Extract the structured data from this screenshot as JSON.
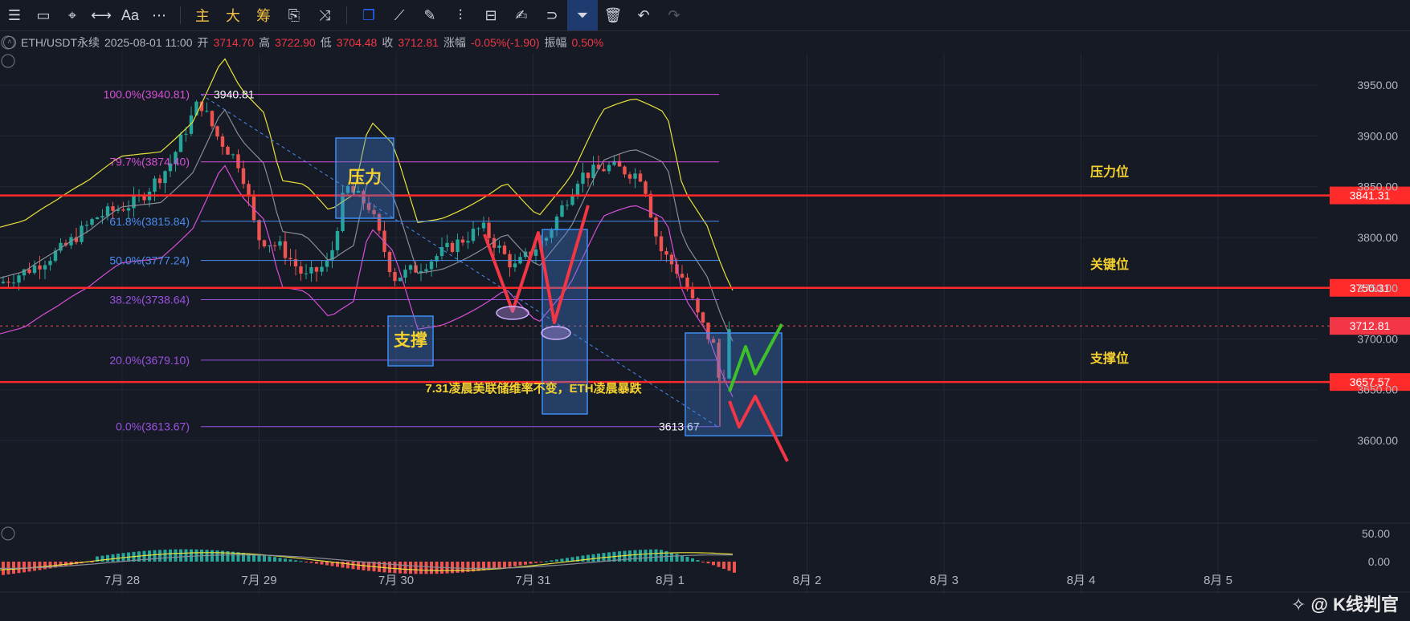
{
  "toolbar": {
    "items": [
      {
        "icon": "menu-icon",
        "glyph": "☰"
      },
      {
        "icon": "rectangle-icon",
        "glyph": "▭"
      },
      {
        "icon": "cursor-icon",
        "glyph": "⌖"
      },
      {
        "icon": "horizontal-line-icon",
        "glyph": "⟷"
      },
      {
        "icon": "text-icon",
        "glyph": "Aa"
      },
      {
        "icon": "more-icon",
        "glyph": "⋯"
      },
      {
        "icon": "main-indicator-button",
        "glyph": "主",
        "gold": true
      },
      {
        "icon": "large-button",
        "glyph": "大",
        "gold": true
      },
      {
        "icon": "chips-button",
        "glyph": "筹",
        "gold": true
      },
      {
        "icon": "compare-icon",
        "glyph": "⎘"
      },
      {
        "icon": "draw-tool-icon",
        "glyph": "⤨"
      },
      {
        "icon": "copy-icon",
        "glyph": "❐",
        "blue": true
      },
      {
        "icon": "ruler-icon",
        "glyph": "⟋"
      },
      {
        "icon": "pen-icon",
        "glyph": "✎"
      },
      {
        "icon": "bar-chart-icon",
        "glyph": "⫶"
      },
      {
        "icon": "trash-can-icon",
        "glyph": "⊟"
      },
      {
        "icon": "note-icon",
        "glyph": "✍"
      },
      {
        "icon": "magnet-icon",
        "glyph": "⊃"
      },
      {
        "icon": "filter-icon",
        "glyph": "⏷",
        "active": true
      },
      {
        "icon": "delete-icon",
        "glyph": "🗑"
      },
      {
        "icon": "undo-icon",
        "glyph": "↶"
      },
      {
        "icon": "redo-icon",
        "glyph": "↷",
        "dim": true
      }
    ]
  },
  "info": {
    "symbol": "ETH/USDT永续",
    "time": "2025-08-01 11:00",
    "open_label": "开",
    "open": "3714.70",
    "high_label": "高",
    "high": "3722.90",
    "low_label": "低",
    "low": "3704.48",
    "close_label": "收",
    "close": "3712.81",
    "change_label": "涨幅",
    "change": "-0.05%(-1.90)",
    "amp_label": "振幅",
    "amp": "0.50%"
  },
  "watermark": "✧ @ K线判官",
  "colors": {
    "bg": "#161a25",
    "up": "#26a69a",
    "down": "#ef5350",
    "keyline": "#ff2b2b",
    "gold": "#f5d130",
    "fib_pink": "#d64fd6",
    "fib_blue": "#4a8cf0"
  },
  "chart_data": {
    "type": "candlestick",
    "price_axis": {
      "ticks": [
        3950,
        3900,
        3850,
        3800,
        3750,
        3700,
        3650,
        3600
      ],
      "tick_labels": [
        "3950.00",
        "3900.00",
        "3850.00",
        "3800.00",
        "3750.00",
        "3700.00",
        "3650.00",
        "3600.00"
      ],
      "range": [
        3570,
        3990
      ]
    },
    "time_axis": {
      "labels": [
        "7月 28",
        "7月 29",
        "7月 30",
        "7月 31",
        "8月 1",
        "8月 2",
        "8月 3",
        "8月 4",
        "8月 5"
      ]
    },
    "macd_axis": {
      "ticks": [
        50,
        0
      ],
      "tick_labels": [
        "50.00",
        "0.00"
      ]
    },
    "key_levels": [
      {
        "value": 3841.31,
        "label": "3841.31",
        "annotation": "压力位"
      },
      {
        "value": 3750.31,
        "label": "3750.31",
        "annotation": "关键位"
      },
      {
        "value": 3657.57,
        "label": "3657.57",
        "annotation": "支撑位"
      }
    ],
    "last_price": {
      "value": 3712.81,
      "label": "3712.81"
    },
    "fibonacci": [
      {
        "ratio": "100.0%(3940.81)",
        "value": 3940.81,
        "color": "pink"
      },
      {
        "ratio": "79.7%(3874.40)",
        "value": 3874.4,
        "color": "pink"
      },
      {
        "ratio": "61.8%(3815.84)",
        "value": 3815.84,
        "color": "blue"
      },
      {
        "ratio": "50.0%(3777.24)",
        "value": 3777.24,
        "color": "blue"
      },
      {
        "ratio": "38.2%(3738.64)",
        "value": 3738.64,
        "color": "violet"
      },
      {
        "ratio": "20.0%(3679.10)",
        "value": 3679.1,
        "color": "violet"
      },
      {
        "ratio": "0.0%(3613.67)",
        "value": 3613.67,
        "color": "violet"
      }
    ],
    "high_marker": {
      "value": 3940.81,
      "label": "3940.81"
    },
    "low_marker": {
      "value": 3613.67,
      "label": "3613.67"
    },
    "annotations": {
      "pressure_box": "压力",
      "support_box": "支撑",
      "news": "7.31凌晨美联储维率不变，ETH凌晨暴跌"
    }
  }
}
